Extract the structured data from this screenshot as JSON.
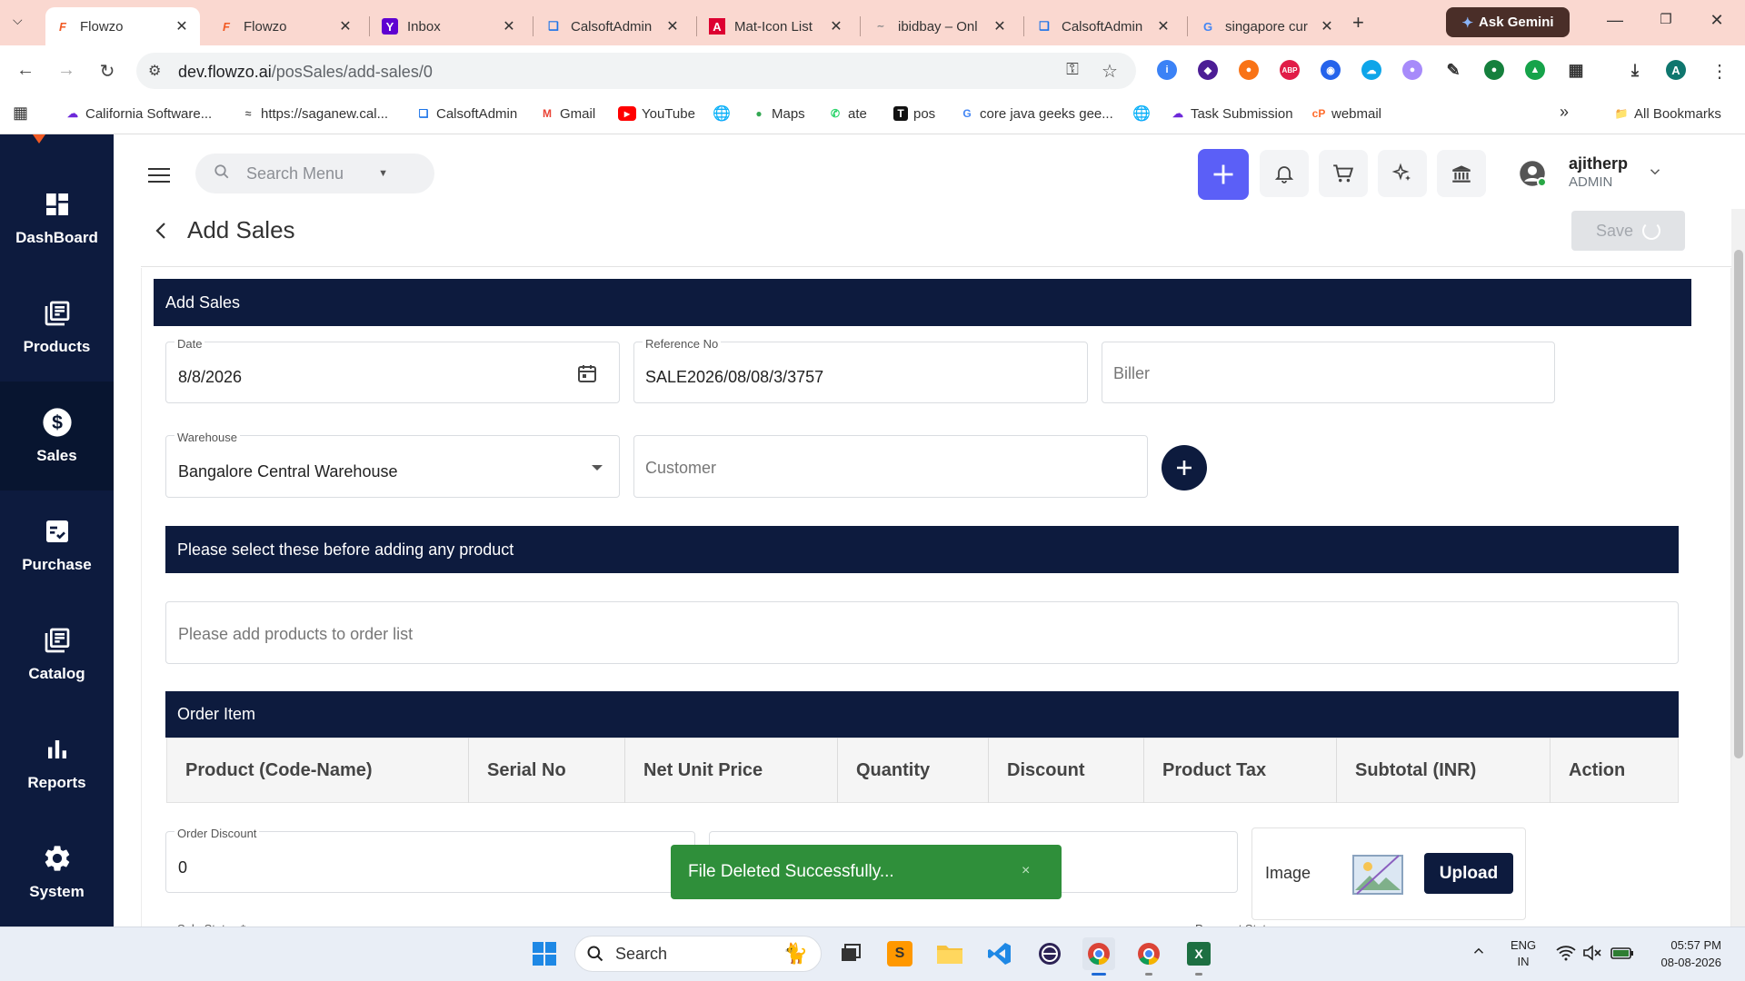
{
  "browser": {
    "tabs": [
      {
        "title": "Flowzo",
        "icon": "flowzo-icon",
        "active": true
      },
      {
        "title": "Flowzo",
        "icon": "flowzo-icon"
      },
      {
        "title": "Inbox",
        "icon": "yahoo-icon"
      },
      {
        "title": "CalsoftAdmin",
        "icon": "calsoft-icon"
      },
      {
        "title": "Mat-Icon List",
        "icon": "angular-icon"
      },
      {
        "title": "ibidbay – Onl",
        "icon": "ibidbay-icon"
      },
      {
        "title": "CalsoftAdmin",
        "icon": "calsoft-icon"
      },
      {
        "title": "singapore cur",
        "icon": "google-icon"
      }
    ],
    "gemini_label": "Ask Gemini",
    "url_host": "dev.flowzo.ai",
    "url_path": "/posSales/add-sales/0",
    "profile_initial": "A",
    "bookmarks": [
      {
        "label": "California Software...",
        "icon": "cloud-icon"
      },
      {
        "label": "https://saganew.cal...",
        "icon": "link-icon"
      },
      {
        "label": "CalsoftAdmin",
        "icon": "calsoft-icon"
      },
      {
        "label": "Gmail",
        "icon": "gmail-icon"
      },
      {
        "label": "YouTube",
        "icon": "youtube-icon"
      },
      {
        "label": "",
        "icon": "globe-icon"
      },
      {
        "label": "Maps",
        "icon": "maps-icon"
      },
      {
        "label": "ate",
        "icon": "whatsapp-icon"
      },
      {
        "label": "pos",
        "icon": "t-icon"
      },
      {
        "label": "core java geeks gee...",
        "icon": "google-icon"
      },
      {
        "label": "",
        "icon": "globe-icon"
      },
      {
        "label": "Task Submission",
        "icon": "cloud-icon"
      },
      {
        "label": "webmail",
        "icon": "cpanel-icon"
      }
    ],
    "all_bookmarks_label": "All Bookmarks"
  },
  "sidebar": {
    "items": [
      {
        "label": "DashBoard",
        "icon": "dashboard-icon"
      },
      {
        "label": "Products",
        "icon": "library-icon"
      },
      {
        "label": "Sales",
        "icon": "dollar-icon",
        "active": true
      },
      {
        "label": "Purchase",
        "icon": "checklist-icon"
      },
      {
        "label": "Catalog",
        "icon": "library-icon"
      },
      {
        "label": "Reports",
        "icon": "bar-chart-icon"
      },
      {
        "label": "System",
        "icon": "gear-icon"
      }
    ]
  },
  "topbar": {
    "search_placeholder": "Search Menu",
    "user_name": "ajitherp",
    "user_role": "ADMIN"
  },
  "page": {
    "title": "Add Sales",
    "save_label": "Save"
  },
  "form": {
    "section_title": "Add Sales",
    "date_label": "Date",
    "date_value": "8/8/2026",
    "reference_label": "Reference No",
    "reference_value": "SALE2026/08/08/3/3757",
    "biller_placeholder": "Biller",
    "warehouse_label": "Warehouse",
    "warehouse_value": "Bangalore Central Warehouse",
    "customer_placeholder": "Customer",
    "notice": "Please select these before adding any product",
    "product_search_placeholder": "Please add products to order list",
    "order_item_title": "Order Item",
    "columns": [
      "Product (Code-Name)",
      "Serial No",
      "Net Unit Price",
      "Quantity",
      "Discount",
      "Product Tax",
      "Subtotal (INR)",
      "Action"
    ],
    "order_discount_label": "Order Discount",
    "order_discount_value": "0",
    "image_label": "Image",
    "upload_label": "Upload",
    "sale_status_label": "Sale Status *",
    "payment_status_label": "Payment Status"
  },
  "toast": {
    "message": "File Deleted Successfully...",
    "close": "×"
  },
  "taskbar": {
    "search_label": "Search",
    "lang": "ENG",
    "region": "IN",
    "time": "05:57 PM",
    "date": "08-08-2026"
  },
  "colors": {
    "sidebar": "#0d1b3e",
    "accent_plus": "#5b5ff7",
    "toast": "#2f8f3a"
  }
}
